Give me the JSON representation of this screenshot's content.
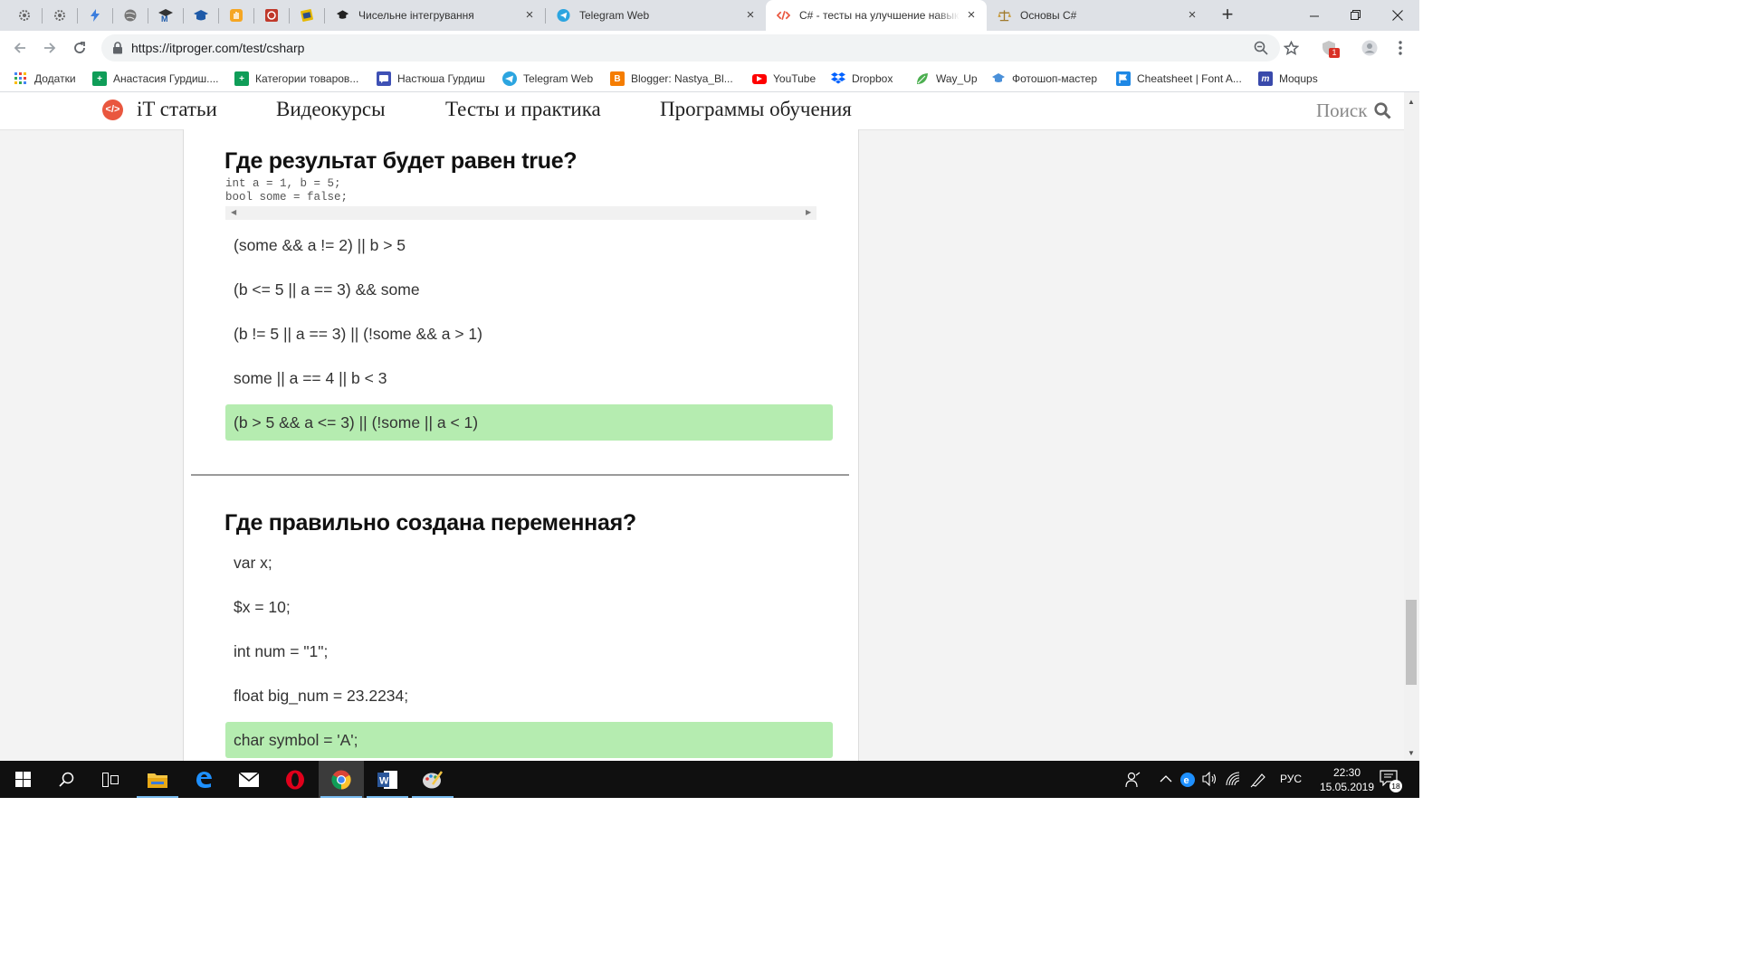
{
  "browser": {
    "pinned_tabs": [
      {
        "icon": "gear-icon",
        "color": "#777777"
      },
      {
        "icon": "gear-icon",
        "color": "#777777"
      },
      {
        "icon": "bolt-icon",
        "color": "#3b7ddd"
      },
      {
        "icon": "globe-icon",
        "color": "#666666"
      },
      {
        "icon": "mortarboard-m-icon",
        "color": "#333333"
      },
      {
        "icon": "mortarboard-icon",
        "color": "#1e5aa8"
      },
      {
        "icon": "hand-icon",
        "color": "#f5a623"
      },
      {
        "icon": "red-badge-icon",
        "color": "#c0392b"
      },
      {
        "icon": "notebook-icon",
        "color": "#e6b800"
      }
    ],
    "tabs": [
      {
        "title": "Чисельне інтегрування",
        "icon": "mortarboard-icon",
        "active": false
      },
      {
        "title": "Telegram Web",
        "icon": "telegram-icon",
        "active": false
      },
      {
        "title": "C# - тесты на улучшение навыков",
        "icon": "code-icon",
        "active": true
      },
      {
        "title": "Основы C#",
        "icon": "scales-icon",
        "active": false
      }
    ],
    "url": "https://itproger.com/test/csharp",
    "extension_badge": "1",
    "bookmarks": [
      {
        "label": "Додатки",
        "icon": "apps-grid-icon",
        "color": "#4285f4"
      },
      {
        "label": "Анастасия Гурдиш....",
        "icon": "plus-icon",
        "color": "#0f9d58"
      },
      {
        "label": "Категории товаров...",
        "icon": "plus-icon",
        "color": "#0f9d58"
      },
      {
        "label": "Настюша Гурдиш",
        "icon": "chat-icon",
        "color": "#3f51b5"
      },
      {
        "label": "Telegram Web",
        "icon": "telegram-icon",
        "color": "#2ca5e0"
      },
      {
        "label": "Blogger: Nastya_Bl...",
        "icon": "blogger-icon",
        "color": "#f57d00"
      },
      {
        "label": "YouTube",
        "icon": "youtube-icon",
        "color": "#ff0000"
      },
      {
        "label": "Dropbox",
        "icon": "dropbox-icon",
        "color": "#0061ff"
      },
      {
        "label": "Way_Up",
        "icon": "leaf-icon",
        "color": "#4caf50"
      },
      {
        "label": "Фотошоп-мастер",
        "icon": "mortarboard-icon",
        "color": "#4a90d9"
      },
      {
        "label": "Cheatsheet | Font A...",
        "icon": "flag-icon",
        "color": "#1e88e5"
      },
      {
        "label": "Moqups",
        "icon": "moqups-icon",
        "color": "#3949ab"
      }
    ]
  },
  "site": {
    "nav": [
      "iT статьи",
      "Видеокурсы",
      "Тесты и практика",
      "Программы обучения"
    ],
    "search_label": "Поиск",
    "logo_color": "#e9573f"
  },
  "questions": [
    {
      "title": "Где результат будет равен true?",
      "code": [
        "int a = 1, b = 5;",
        "bool some = false;"
      ],
      "options": [
        {
          "text": "(some && a != 2) || b > 5",
          "correct": false
        },
        {
          "text": "(b <= 5 || a == 3) && some",
          "correct": false
        },
        {
          "text": "(b != 5 || a == 3) || (!some && a > 1)",
          "correct": false
        },
        {
          "text": "some || a == 4 || b < 3",
          "correct": false
        },
        {
          "text": "(b > 5 && a <= 3) || (!some || a < 1)",
          "correct": true
        }
      ]
    },
    {
      "title": "Где правильно создана переменная?",
      "code": [],
      "options": [
        {
          "text": "var x;",
          "correct": false
        },
        {
          "text": "$x = 10;",
          "correct": false
        },
        {
          "text": "int num = \"1\";",
          "correct": false
        },
        {
          "text": "float big_num = 23.2234;",
          "correct": false
        },
        {
          "text": "char symbol = 'A';",
          "correct": true
        }
      ]
    }
  ],
  "colors": {
    "correct_answer": "#b5ecb0",
    "page_bg": "#f3f3f3",
    "taskbar": "#101010"
  },
  "taskbar": {
    "apps": [
      "start-icon",
      "search-icon",
      "task-view-icon",
      "file-explorer-icon",
      "edge-icon",
      "mail-icon",
      "opera-icon",
      "chrome-icon",
      "word-icon",
      "paint-icon"
    ],
    "active_app": "chrome-icon",
    "language": "РУС",
    "time": "22:30",
    "date": "15.05.2019",
    "notifications": "18"
  }
}
